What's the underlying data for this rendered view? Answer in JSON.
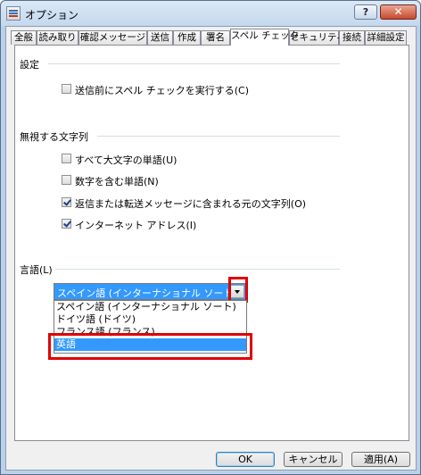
{
  "window": {
    "title": "オプション",
    "help_label": "?",
    "close_label": "✕"
  },
  "tabs": [
    {
      "label": "全般"
    },
    {
      "label": "読み取り"
    },
    {
      "label": "確認メッセージ"
    },
    {
      "label": "送信"
    },
    {
      "label": "作成"
    },
    {
      "label": "署名"
    },
    {
      "label": "スペル チェック",
      "active": true
    },
    {
      "label": "セキュリティ"
    },
    {
      "label": "接続"
    },
    {
      "label": "詳細設定"
    }
  ],
  "settings": {
    "header": "設定",
    "items": [
      {
        "label": "送信前にスペル チェックを実行する(C)",
        "checked": false
      }
    ]
  },
  "ignore": {
    "header": "無視する文字列",
    "items": [
      {
        "label": "すべて大文字の単語(U)",
        "checked": false
      },
      {
        "label": "数字を含む単語(N)",
        "checked": false
      },
      {
        "label": "返信または転送メッセージに含まれる元の文字列(O)",
        "checked": true
      },
      {
        "label": "インターネット アドレス(I)",
        "checked": true
      }
    ]
  },
  "language": {
    "header": "言語(L)",
    "selected": "スペイン語 (インターナショナル ソート)",
    "options": [
      "スペイン語 (インターナショナル ソート)",
      "ドイツ語 (ドイツ)",
      "フランス語 (フランス)",
      "英語"
    ],
    "highlighted_index": 3
  },
  "buttons": {
    "ok": "OK",
    "cancel": "キャンセル",
    "apply": "適用(A)"
  },
  "colors": {
    "highlight": "#3399ff",
    "annotation": "#e00000"
  }
}
